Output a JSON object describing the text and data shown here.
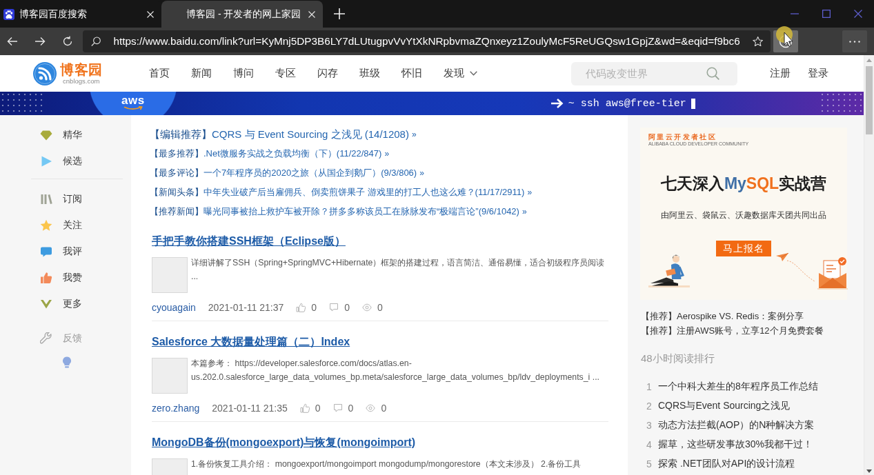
{
  "browser": {
    "tabs": [
      {
        "title": "博客园百度搜索",
        "favicon": true,
        "selected": false
      },
      {
        "title": "博客园 - 开发者的网上家园",
        "favicon": false,
        "selected": true
      }
    ],
    "address": "https://www.baidu.com/link?url=KyMnj5DP3B6LY7dLUtugpvVvYtXkNRpbvmaZQnxeyz1ZoulyMcF5ReUGQsw1GpjZ&wd=&eqid=f9bc6"
  },
  "site_header": {
    "logo": {
      "name": "博客园",
      "domain": "cnblogs.com"
    },
    "nav": [
      {
        "label": "首页",
        "has_menu": false
      },
      {
        "label": "新闻",
        "has_menu": false
      },
      {
        "label": "博问",
        "has_menu": false
      },
      {
        "label": "专区",
        "has_menu": false
      },
      {
        "label": "闪存",
        "has_menu": false
      },
      {
        "label": "班级",
        "has_menu": false
      },
      {
        "label": "怀旧",
        "has_menu": false
      },
      {
        "label": "发现",
        "has_menu": true
      }
    ],
    "search": {
      "placeholder": "代码改变世界"
    },
    "account_links": [
      "注册",
      "登录"
    ]
  },
  "banner": {
    "brand": "aws",
    "command": "~ ssh aws@free-tier"
  },
  "side_nav": {
    "groups": [
      {
        "kind": "main",
        "items": [
          {
            "label": "精华"
          },
          {
            "label": "候选"
          }
        ]
      },
      {
        "kind": "main",
        "items": [
          {
            "label": "订阅"
          },
          {
            "label": "关注"
          },
          {
            "label": "我评"
          },
          {
            "label": "我赞"
          },
          {
            "label": "更多"
          }
        ]
      },
      {
        "kind": "feedback",
        "items": [
          {
            "label": "反馈"
          }
        ]
      }
    ]
  },
  "headlines": [
    {
      "tag": "【编辑推荐】",
      "title": "CQRS 与 Event Sourcing 之浅见 (14/1208)",
      "more": "»",
      "featured": true
    },
    {
      "tag": "【最多推荐】",
      "title": ".Net微服务实战之负载均衡（下）(11/22/847)",
      "more": "»",
      "featured": false
    },
    {
      "tag": "【最多评论】",
      "title": "一个7年程序员的2020之旅（从国企到鹅厂）(9/3/806)",
      "more": "»",
      "featured": false
    },
    {
      "tag": "【新闻头条】",
      "title": "中年失业破产后当雇佣兵、倒卖煎饼果子 游戏里的打工人也这么难？(11/17/2911)",
      "more": "»",
      "featured": false
    },
    {
      "tag": "【推荐新闻】",
      "title": "曝光同事被抬上救护车被开除？拼多多称该员工在脉脉发布“极端言论”(9/6/1042)",
      "more": "»",
      "featured": false
    }
  ],
  "posts": [
    {
      "title": "手把手教你搭建SSH框架（Eclipse版）",
      "summary": "详细讲解了SSH（Spring+SpringMVC+Hibernate）框架的搭建过程，语言简洁、通俗易懂，适合初级程序员阅读 ...",
      "author": "cyouagain",
      "date": "2021-01-11 21:37",
      "likes": "0",
      "comments": "0",
      "views": "0"
    },
    {
      "title": "Salesforce 大数据量处理篇（二）Index",
      "summary": "本篇参考： https://developer.salesforce.com/docs/atlas.en-us.202.0.salesforce_large_data_volumes_bp.meta/salesforce_large_data_volumes_bp/ldv_deployments_i ...",
      "author": "zero.zhang",
      "date": "2021-01-11 21:35",
      "likes": "0",
      "comments": "0",
      "views": "0"
    },
    {
      "title": "MongoDB备份(mongoexport)与恢复(mongoimport)",
      "summary": "1.备份恢复工具介绍： mongoexport/mongoimport mongodump/mongorestore（本文未涉及） 2.备份工具"
    }
  ],
  "right_rail": {
    "ad": {
      "brand": "阿里云开发者社区",
      "brand_en": "ALIBABA CLOUD DEVELOPER COMMUNITY",
      "headline": [
        {
          "text": "七天深入"
        },
        {
          "text": "My",
          "color": "#3f6fa6"
        },
        {
          "text": "SQL",
          "color": "#f0711e"
        },
        {
          "text": "实战营"
        }
      ],
      "subtitle": "由阿里云、袋鼠云、沃趣数据库天团共同出品",
      "button": "马上报名"
    },
    "promos": [
      "【推荐】Aerospike VS. Redis：案例分享",
      "【推荐】注册AWS账号，立享12个月免费套餐"
    ],
    "ranking": {
      "title": "48小时阅读排行",
      "items": [
        {
          "rank": "1",
          "title": "一个中科大差生的8年程序员工作总结"
        },
        {
          "rank": "2",
          "title": "CQRS与Event Sourcing之浅见"
        },
        {
          "rank": "3",
          "title": "动态方法拦截(AOP）的N种解决方案"
        },
        {
          "rank": "4",
          "title": "握草，这些研发事故30%我都干过！"
        },
        {
          "rank": "5",
          "title": "探索 .NET团队对API的设计流程"
        }
      ]
    }
  }
}
